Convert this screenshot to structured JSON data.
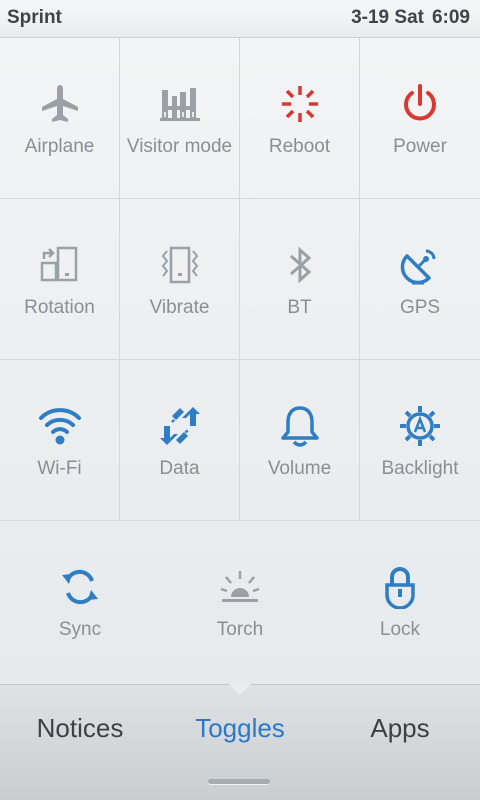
{
  "status_bar": {
    "carrier": "Sprint",
    "date": "3-19 Sat",
    "time": "6:09"
  },
  "toggles": [
    {
      "label": "Airplane",
      "icon": "airplane-icon",
      "color": "#9aa0a5"
    },
    {
      "label": "Visitor mode",
      "icon": "visitor-mode-icon",
      "color": "#9aa0a5"
    },
    {
      "label": "Reboot",
      "icon": "reboot-icon",
      "color": "#d8382f"
    },
    {
      "label": "Power",
      "icon": "power-icon",
      "color": "#d8382f"
    },
    {
      "label": "Rotation",
      "icon": "rotation-icon",
      "color": "#9aa0a5"
    },
    {
      "label": "Vibrate",
      "icon": "vibrate-icon",
      "color": "#9aa0a5"
    },
    {
      "label": "BT",
      "icon": "bluetooth-icon",
      "color": "#9aa0a5"
    },
    {
      "label": "GPS",
      "icon": "gps-icon",
      "color": "#2f7dc2"
    },
    {
      "label": "Wi-Fi",
      "icon": "wifi-icon",
      "color": "#2f7dc2"
    },
    {
      "label": "Data",
      "icon": "data-icon",
      "color": "#2f7dc2"
    },
    {
      "label": "Volume",
      "icon": "volume-icon",
      "color": "#2f7dc2"
    },
    {
      "label": "Backlight",
      "icon": "backlight-icon",
      "color": "#2f7dc2"
    },
    {
      "label": "Sync",
      "icon": "sync-icon",
      "color": "#2f7dc2"
    },
    {
      "label": "Torch",
      "icon": "torch-icon",
      "color": "#9aa0a5"
    },
    {
      "label": "Lock",
      "icon": "lock-icon",
      "color": "#2f7dc2"
    }
  ],
  "tabs": [
    {
      "label": "Notices",
      "active": false
    },
    {
      "label": "Toggles",
      "active": true
    },
    {
      "label": "Apps",
      "active": false
    }
  ],
  "colors": {
    "accent": "#2b79c8",
    "inactive_icon": "#9aa0a5",
    "alert": "#d8382f"
  }
}
